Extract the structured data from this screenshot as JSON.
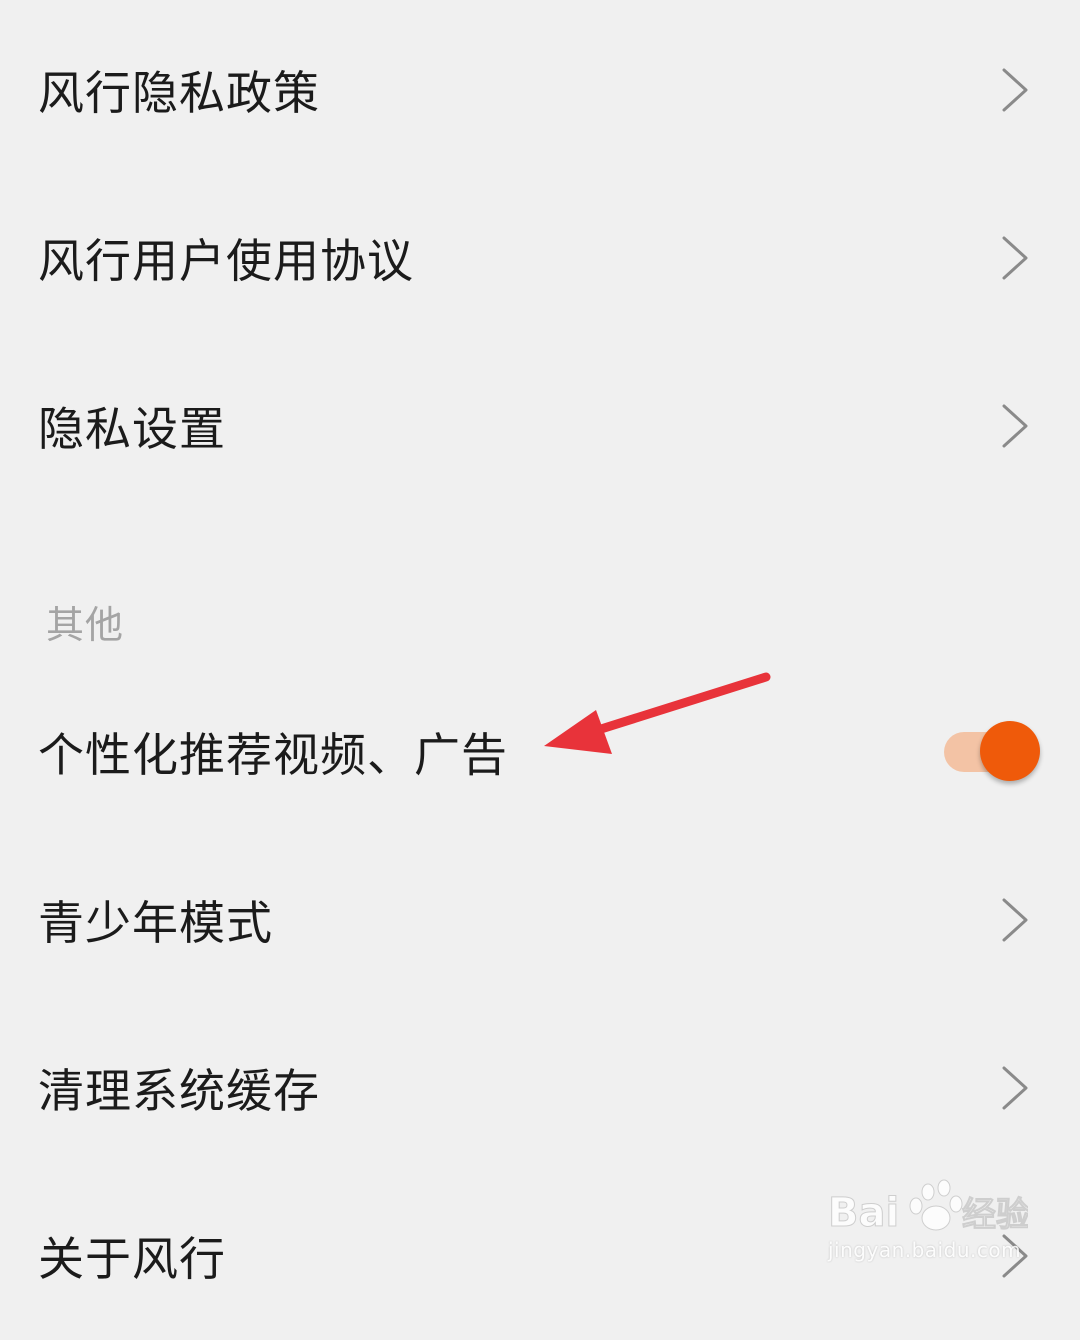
{
  "settings": {
    "items_top": [
      {
        "label": "风行隐私政策",
        "type": "link"
      },
      {
        "label": "风行用户使用协议",
        "type": "link"
      },
      {
        "label": "隐私设置",
        "type": "link"
      }
    ],
    "section_other": {
      "header": "其他",
      "toggle_item": {
        "label": "个性化推荐视频、广告",
        "enabled": true
      },
      "items": [
        {
          "label": "青少年模式",
          "type": "link"
        },
        {
          "label": "清理系统缓存",
          "type": "link"
        },
        {
          "label": "关于风行",
          "type": "link"
        }
      ]
    }
  },
  "icons": {
    "chevron": "chevron-right-icon",
    "annotation": "red-arrow-annotation"
  },
  "colors": {
    "background": "#f0f0f0",
    "text": "#1b1b1b",
    "section_header": "#a4a4a4",
    "chevron": "#8a8a8a",
    "toggle_knob": "#ef5a0a",
    "toggle_track": "#f3c3a5",
    "annotation_arrow": "#e8333a"
  },
  "watermark": {
    "brand": "Bai du 经验",
    "url": "jingyan.baidu.com"
  }
}
